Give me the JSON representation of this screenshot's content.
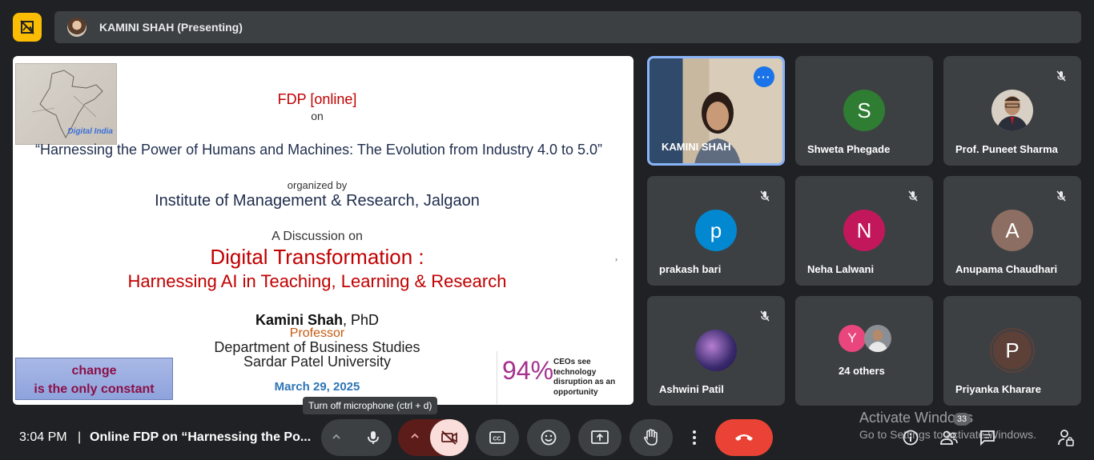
{
  "header": {
    "presenter_label": "KAMINI SHAH (Presenting)"
  },
  "slide": {
    "map_label": "Digital India",
    "fdp": "FDP [online]",
    "on": "on",
    "title": "“Harnessing the Power of Humans and Machines: The Evolution from Industry 4.0 to 5.0”",
    "organized_by": "organized by",
    "institute": "Institute of Management & Research, Jalgaon",
    "discussion": "A Discussion on",
    "topic": "Digital Transformation :",
    "subtopic": "Harnessing AI in Teaching, Learning & Research",
    "author_name": "Kamini Shah",
    "author_degree": ", PhD",
    "position": "Professor",
    "department": "Department of Business Studies",
    "university": "Sardar Patel University",
    "date": "March 29, 2025",
    "change_line1": "change",
    "change_line2": "is the only constant",
    "stat_percent": "94%",
    "stat_text_1": "CEOs see",
    "stat_text_2": "technology",
    "stat_text_3": "disruption as an",
    "stat_text_4": "opportunity"
  },
  "participants": [
    {
      "name": "KAMINI SHAH",
      "type": "video"
    },
    {
      "name": "Shweta Phegade",
      "initial": "S",
      "color": "#2e7d32"
    },
    {
      "name": "Prof. Puneet Sharma",
      "type": "photo"
    },
    {
      "name": "prakash bari",
      "initial": "p",
      "color": "#0288d1"
    },
    {
      "name": "Neha Lalwani",
      "initial": "N",
      "color": "#c2185b"
    },
    {
      "name": "Anupama Chaudhari",
      "initial": "A",
      "color": "#8d6e63"
    },
    {
      "name": "Ashwini Patil",
      "type": "photo"
    },
    {
      "name": "24 others",
      "initial": "Y",
      "color": "#e8467c"
    },
    {
      "name": "Priyanka Kharare",
      "initial": "P",
      "color": "#5d4037"
    }
  ],
  "bottom_bar": {
    "time": "3:04 PM",
    "separator": "|",
    "meeting_title": "Online FDP on “Harnessing the Po...",
    "tooltip": "Turn off microphone (ctrl + d)",
    "people_count": "33"
  },
  "watermark": {
    "line1": "Activate Windows",
    "line2": "Go to Settings to activate Windows."
  },
  "colors": {
    "background": "#202124",
    "tile": "#3c4043",
    "accent_yellow": "#fbbc04",
    "end_call": "#ea4335",
    "camera_off": "#f9dedc",
    "speaking_border": "#8ab4f8"
  }
}
